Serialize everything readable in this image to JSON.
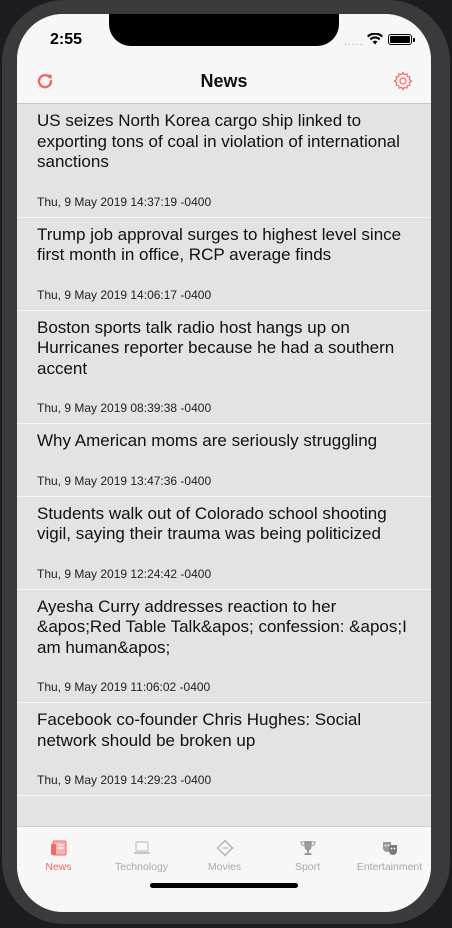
{
  "status_bar": {
    "time": "2:55",
    "signal": "....."
  },
  "nav": {
    "title": "News",
    "left_icon": "refresh-icon",
    "right_icon": "gear-icon"
  },
  "colors": {
    "accent": "#f06a6a",
    "list_bg": "#e3e3e3",
    "bar_bg": "#f7f7f7"
  },
  "articles": [
    {
      "title": "US seizes North Korea cargo ship linked to exporting tons of coal in violation of international sanctions",
      "date": "Thu, 9 May 2019 14:37:19 -0400"
    },
    {
      "title": "Trump job approval surges to highest level since first month in office, RCP average finds",
      "date": "Thu, 9 May 2019 14:06:17 -0400"
    },
    {
      "title": "Boston sports talk radio host hangs up on Hurricanes reporter because he had a southern accent",
      "date": "Thu, 9 May 2019 08:39:38 -0400"
    },
    {
      "title": "Why American moms are seriously struggling",
      "date": "Thu, 9 May 2019 13:47:36 -0400"
    },
    {
      "title": "Students walk out of Colorado school shooting vigil, saying their trauma was being politicized",
      "date": "Thu, 9 May 2019 12:24:42 -0400"
    },
    {
      "title": "Ayesha Curry addresses reaction to her &apos;Red Table Talk&apos; confession: &apos;I am human&apos;",
      "date": "Thu, 9 May 2019 11:06:02 -0400"
    },
    {
      "title": "Facebook co-founder Chris Hughes: Social network should be broken up",
      "date": "Thu, 9 May 2019 14:29:23 -0400"
    }
  ],
  "tabs": [
    {
      "label": "News",
      "icon": "newspaper-icon",
      "active": true
    },
    {
      "label": "Technology",
      "icon": "laptop-icon",
      "active": false
    },
    {
      "label": "Movies",
      "icon": "ticket-icon",
      "active": false
    },
    {
      "label": "Sport",
      "icon": "trophy-icon",
      "active": false
    },
    {
      "label": "Entertainment",
      "icon": "theater-masks-icon",
      "active": false
    }
  ]
}
